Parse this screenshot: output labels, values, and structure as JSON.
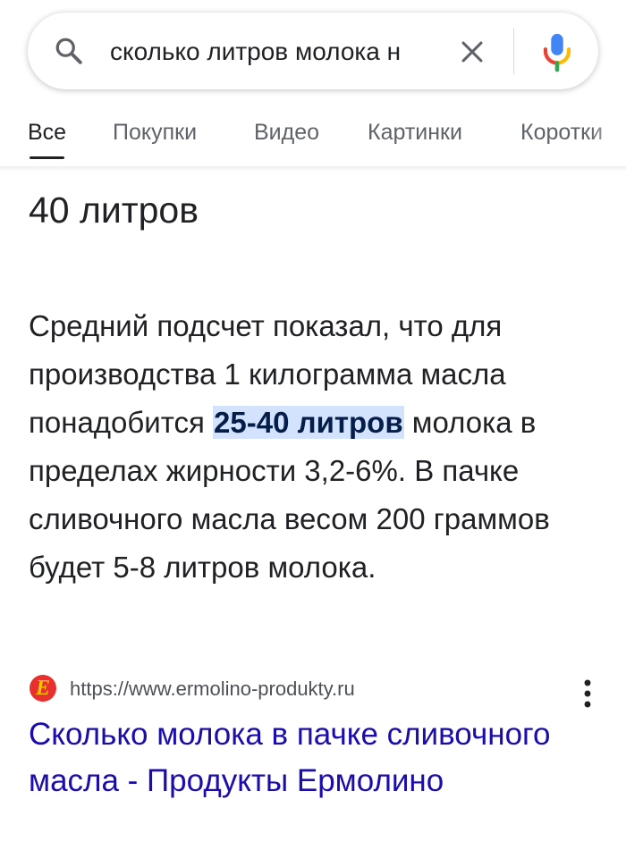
{
  "search": {
    "query": "сколько литров молока н",
    "icons": {
      "search": "search-icon",
      "clear": "close-icon",
      "voice": "microphone-icon"
    }
  },
  "tabs": [
    {
      "label": "Все",
      "active": true
    },
    {
      "label": "Покупки",
      "active": false
    },
    {
      "label": "Видео",
      "active": false
    },
    {
      "label": "Картинки",
      "active": false
    },
    {
      "label": "Коротки",
      "active": false
    }
  ],
  "answer": {
    "title": "40 литров",
    "snippet_before": "Средний подсчет показал, что для производства 1 килограмма масла понадобится ",
    "snippet_highlight": "25-40 литров",
    "snippet_after": " молока в пределах жирности 3,2-6%. В пачке сливочного масла весом 200 граммов будет 5-8 литров молока."
  },
  "source": {
    "favicon_letter": "Е",
    "url": "https://www.ermolino-produkty.ru",
    "more_icon": "more-vert-icon",
    "title": "Сколько молока в пачке сливочного масла - Продукты Ермолино"
  },
  "colors": {
    "link": "#1a0dab",
    "highlight_bg": "#d3e3fd",
    "highlight_text": "#041e49",
    "text": "#202124",
    "secondary": "#5f6368"
  }
}
